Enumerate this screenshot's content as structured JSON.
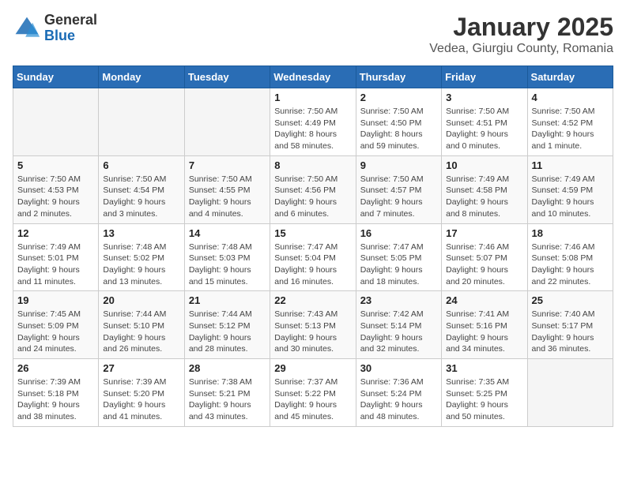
{
  "header": {
    "logo_general": "General",
    "logo_blue": "Blue",
    "title": "January 2025",
    "subtitle": "Vedea, Giurgiu County, Romania"
  },
  "weekdays": [
    "Sunday",
    "Monday",
    "Tuesday",
    "Wednesday",
    "Thursday",
    "Friday",
    "Saturday"
  ],
  "weeks": [
    [
      {
        "day": "",
        "info": ""
      },
      {
        "day": "",
        "info": ""
      },
      {
        "day": "",
        "info": ""
      },
      {
        "day": "1",
        "info": "Sunrise: 7:50 AM\nSunset: 4:49 PM\nDaylight: 8 hours and 58 minutes."
      },
      {
        "day": "2",
        "info": "Sunrise: 7:50 AM\nSunset: 4:50 PM\nDaylight: 8 hours and 59 minutes."
      },
      {
        "day": "3",
        "info": "Sunrise: 7:50 AM\nSunset: 4:51 PM\nDaylight: 9 hours and 0 minutes."
      },
      {
        "day": "4",
        "info": "Sunrise: 7:50 AM\nSunset: 4:52 PM\nDaylight: 9 hours and 1 minute."
      }
    ],
    [
      {
        "day": "5",
        "info": "Sunrise: 7:50 AM\nSunset: 4:53 PM\nDaylight: 9 hours and 2 minutes."
      },
      {
        "day": "6",
        "info": "Sunrise: 7:50 AM\nSunset: 4:54 PM\nDaylight: 9 hours and 3 minutes."
      },
      {
        "day": "7",
        "info": "Sunrise: 7:50 AM\nSunset: 4:55 PM\nDaylight: 9 hours and 4 minutes."
      },
      {
        "day": "8",
        "info": "Sunrise: 7:50 AM\nSunset: 4:56 PM\nDaylight: 9 hours and 6 minutes."
      },
      {
        "day": "9",
        "info": "Sunrise: 7:50 AM\nSunset: 4:57 PM\nDaylight: 9 hours and 7 minutes."
      },
      {
        "day": "10",
        "info": "Sunrise: 7:49 AM\nSunset: 4:58 PM\nDaylight: 9 hours and 8 minutes."
      },
      {
        "day": "11",
        "info": "Sunrise: 7:49 AM\nSunset: 4:59 PM\nDaylight: 9 hours and 10 minutes."
      }
    ],
    [
      {
        "day": "12",
        "info": "Sunrise: 7:49 AM\nSunset: 5:01 PM\nDaylight: 9 hours and 11 minutes."
      },
      {
        "day": "13",
        "info": "Sunrise: 7:48 AM\nSunset: 5:02 PM\nDaylight: 9 hours and 13 minutes."
      },
      {
        "day": "14",
        "info": "Sunrise: 7:48 AM\nSunset: 5:03 PM\nDaylight: 9 hours and 15 minutes."
      },
      {
        "day": "15",
        "info": "Sunrise: 7:47 AM\nSunset: 5:04 PM\nDaylight: 9 hours and 16 minutes."
      },
      {
        "day": "16",
        "info": "Sunrise: 7:47 AM\nSunset: 5:05 PM\nDaylight: 9 hours and 18 minutes."
      },
      {
        "day": "17",
        "info": "Sunrise: 7:46 AM\nSunset: 5:07 PM\nDaylight: 9 hours and 20 minutes."
      },
      {
        "day": "18",
        "info": "Sunrise: 7:46 AM\nSunset: 5:08 PM\nDaylight: 9 hours and 22 minutes."
      }
    ],
    [
      {
        "day": "19",
        "info": "Sunrise: 7:45 AM\nSunset: 5:09 PM\nDaylight: 9 hours and 24 minutes."
      },
      {
        "day": "20",
        "info": "Sunrise: 7:44 AM\nSunset: 5:10 PM\nDaylight: 9 hours and 26 minutes."
      },
      {
        "day": "21",
        "info": "Sunrise: 7:44 AM\nSunset: 5:12 PM\nDaylight: 9 hours and 28 minutes."
      },
      {
        "day": "22",
        "info": "Sunrise: 7:43 AM\nSunset: 5:13 PM\nDaylight: 9 hours and 30 minutes."
      },
      {
        "day": "23",
        "info": "Sunrise: 7:42 AM\nSunset: 5:14 PM\nDaylight: 9 hours and 32 minutes."
      },
      {
        "day": "24",
        "info": "Sunrise: 7:41 AM\nSunset: 5:16 PM\nDaylight: 9 hours and 34 minutes."
      },
      {
        "day": "25",
        "info": "Sunrise: 7:40 AM\nSunset: 5:17 PM\nDaylight: 9 hours and 36 minutes."
      }
    ],
    [
      {
        "day": "26",
        "info": "Sunrise: 7:39 AM\nSunset: 5:18 PM\nDaylight: 9 hours and 38 minutes."
      },
      {
        "day": "27",
        "info": "Sunrise: 7:39 AM\nSunset: 5:20 PM\nDaylight: 9 hours and 41 minutes."
      },
      {
        "day": "28",
        "info": "Sunrise: 7:38 AM\nSunset: 5:21 PM\nDaylight: 9 hours and 43 minutes."
      },
      {
        "day": "29",
        "info": "Sunrise: 7:37 AM\nSunset: 5:22 PM\nDaylight: 9 hours and 45 minutes."
      },
      {
        "day": "30",
        "info": "Sunrise: 7:36 AM\nSunset: 5:24 PM\nDaylight: 9 hours and 48 minutes."
      },
      {
        "day": "31",
        "info": "Sunrise: 7:35 AM\nSunset: 5:25 PM\nDaylight: 9 hours and 50 minutes."
      },
      {
        "day": "",
        "info": ""
      }
    ]
  ]
}
